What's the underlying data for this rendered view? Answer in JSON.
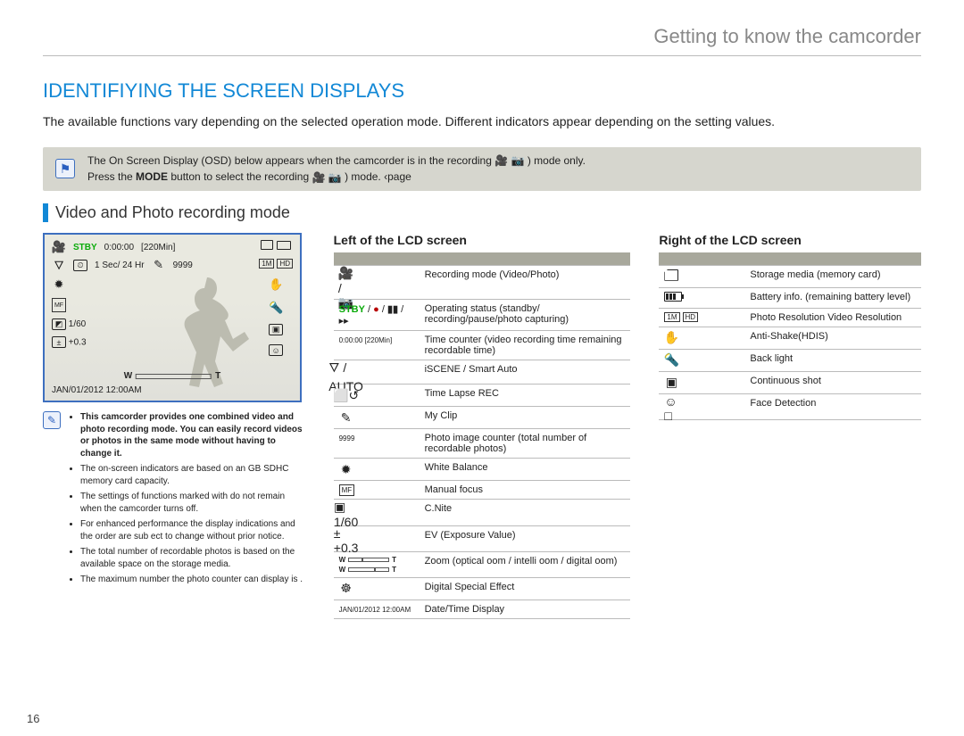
{
  "header": {
    "title": "Getting to know the camcorder"
  },
  "section": {
    "title": "IDENTIFIYING THE SCREEN DISPLAYS"
  },
  "intro": "The available functions vary depending on the selected operation mode. Different indicators appear depending on the setting values.",
  "note_box": {
    "line1_pre": "The On Screen Display (OSD) below appears when the camcorder is in the recording",
    "line1_post": " ) mode only.",
    "line2_pre": "Press the ",
    "line2_mode": "MODE",
    "line2_mid": " button to select the recording",
    "line2_post": " ) mode. ‹page"
  },
  "subhead": "Video and Photo recording mode",
  "lcd": {
    "stby": "STBY",
    "time": "0:00:00",
    "remain": "[220Min]",
    "interval": "1 Sec/ 24 Hr",
    "photos": "9999",
    "cnite": "1/60",
    "ev": "+0.3",
    "w": "W",
    "t": "T",
    "datetime": "JAN/01/2012 12:00AM",
    "hd": "HD"
  },
  "footnotes": {
    "bold": "This camcorder provides one combined video and photo recording mode. You can easily record videos or photos in the same mode without having to change it.",
    "p2": "The on-screen indicators are based on an GB SDHC memory card capacity.",
    "p3": "The settings of functions marked with  do not remain when the camcorder turns off.",
    "p4": "For enhanced performance the display indications and the order are sub ect to change without prior notice.",
    "p5": "The total number of recordable photos is based on the available space on the storage media.",
    "p6": "The maximum number the photo counter can display is ."
  },
  "left_table": {
    "title": "Left of the LCD screen",
    "rows": [
      {
        "icon": "🎥 / 📷",
        "desc": "Recording mode (Video/Photo)"
      },
      {
        "icon": "op-status",
        "desc": "Operating status (standby/ recording/pause/photo capturing)"
      },
      {
        "icon_text": "0:00:00 [220Min]",
        "desc": "Time counter (video recording time remaining recordable time)"
      },
      {
        "icon": "🜄 / AUTO",
        "desc": "iSCENE / Smart Auto"
      },
      {
        "icon": "⬜↺",
        "desc": "Time Lapse REC"
      },
      {
        "icon": "✎",
        "desc": "My Clip"
      },
      {
        "icon_text": "9999",
        "desc": "Photo image counter (total number of recordable photos)"
      },
      {
        "icon": "✹",
        "desc": "White Balance"
      },
      {
        "icon": "MF",
        "desc": "Manual focus"
      },
      {
        "icon": "▣ 1/60",
        "desc": "C.Nite"
      },
      {
        "icon": "± +0.3",
        "desc": "EV (Exposure Value)"
      },
      {
        "icon": "zoom-bar",
        "desc": "Zoom (optical oom / intelli oom / digital oom)"
      },
      {
        "icon": "☸",
        "desc": "Digital Special Effect"
      },
      {
        "icon_text": "JAN/01/2012 12:00AM",
        "desc": "Date/Time Display"
      }
    ]
  },
  "right_table": {
    "title": "Right of the LCD screen",
    "rows": [
      {
        "icon": "card",
        "desc": "Storage media (memory card)"
      },
      {
        "icon": "battery",
        "desc": "Battery info. (remaining battery level)"
      },
      {
        "icon": "res",
        "desc": "Photo Resolution Video Resolution"
      },
      {
        "icon": "✋",
        "desc": "Anti-Shake(HDIS)"
      },
      {
        "icon": "🔦",
        "desc": "Back light"
      },
      {
        "icon": "▣",
        "desc": "Continuous shot"
      },
      {
        "icon": "☺□",
        "desc": "Face Detection"
      }
    ]
  },
  "page_num": "16"
}
